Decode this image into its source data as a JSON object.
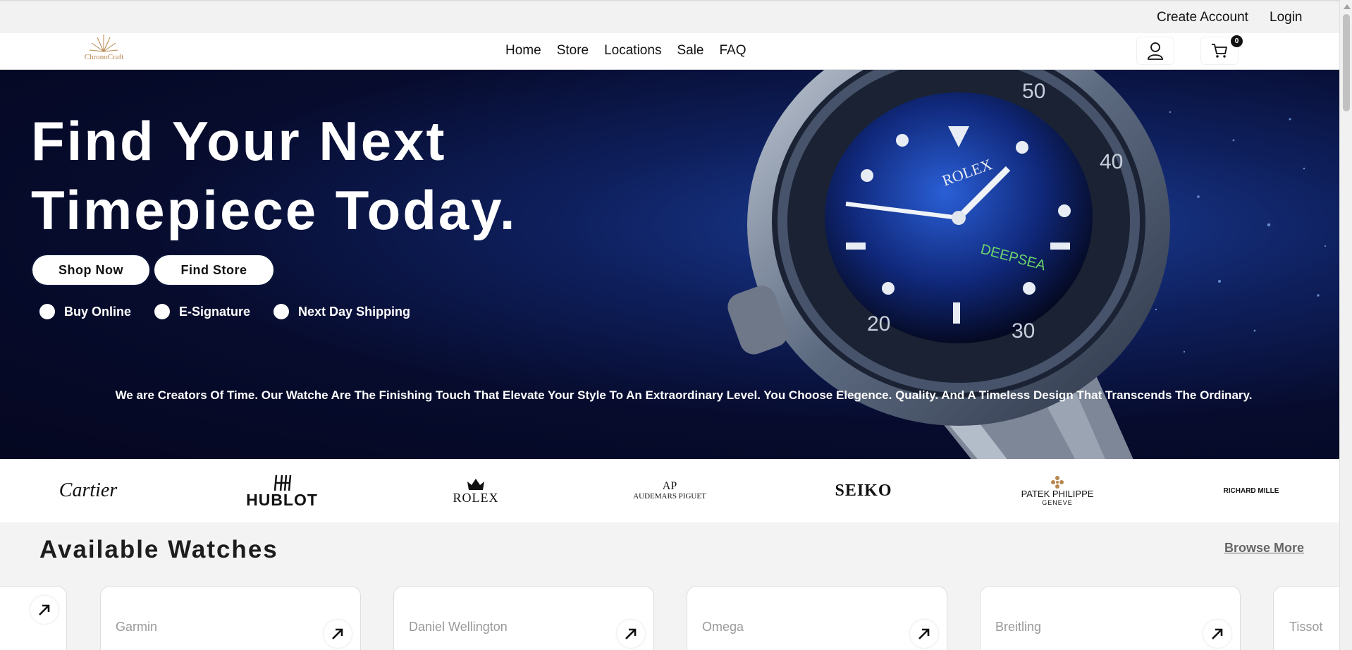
{
  "topbar": {
    "create_account": "Create Account",
    "login": "Login"
  },
  "brand": {
    "logo_text": "ChronoCraft"
  },
  "nav": {
    "items": [
      "Home",
      "Store",
      "Locations",
      "Sale",
      "FAQ"
    ]
  },
  "cart": {
    "count": "0"
  },
  "hero": {
    "title_line1": "Find Your Next",
    "title_line2": "Timepiece Today.",
    "shop_button": "Shop Now",
    "find_button": "Find Store",
    "features": [
      "Buy Online",
      "E-Signature",
      "Next Day Shipping"
    ],
    "tagline": "We are Creators Of Time. Our Watche Are The Finishing Touch That Elevate Your Style To An Extraordinary Level. You Choose Elegence. Quality. And A Timeless Design That Transcends The Ordinary."
  },
  "brands": [
    "Cartier",
    "HUBLOT",
    "ROLEX",
    "AUDEMARS PIGUET",
    "SEIKO",
    "PATEK PHILIPPE",
    "GENEVE",
    "RICHARD MILLE"
  ],
  "watches": {
    "title": "Available Watches",
    "browse_more": "Browse More",
    "cards": [
      "Garmin",
      "Daniel Wellington",
      "Omega",
      "Breitling",
      "Tissot"
    ]
  },
  "colors": {
    "hero_bg": "#070c2e",
    "accent_gold": "#b8874f",
    "text": "#111111"
  }
}
